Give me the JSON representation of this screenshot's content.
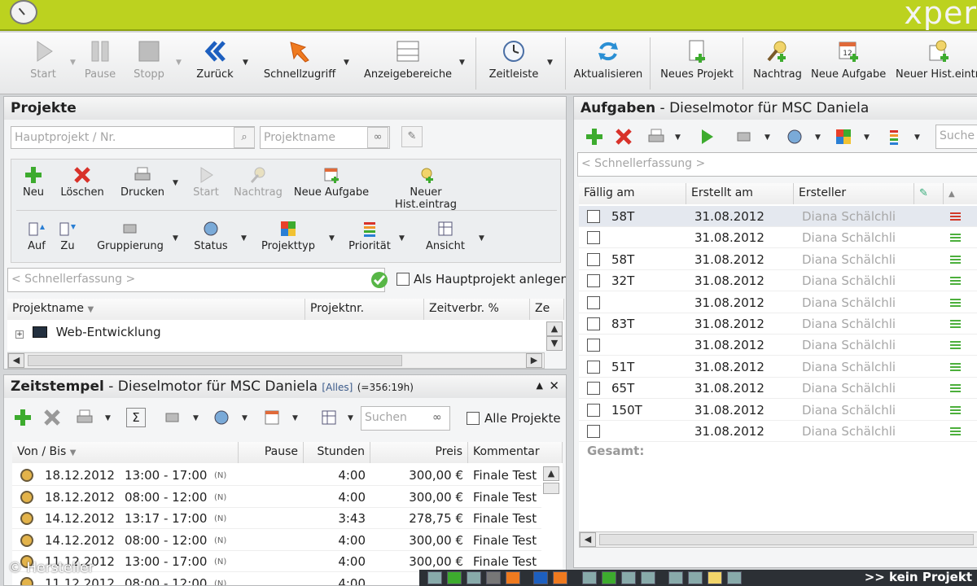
{
  "window": {
    "brand": "xper"
  },
  "toolbar": {
    "buttons": [
      {
        "label": "Start",
        "icon": "play-icon",
        "disabled": true
      },
      {
        "label": "Pause",
        "icon": "pause-icon",
        "disabled": true
      },
      {
        "label": "Stopp",
        "icon": "stop-icon",
        "disabled": true
      },
      {
        "label": "Zurück",
        "icon": "back-icon",
        "disabled": false
      },
      {
        "label": "Schnellzugriff",
        "icon": "quick-access-icon",
        "disabled": false
      },
      {
        "label": "Anzeigebereiche",
        "icon": "display-areas-icon",
        "disabled": false
      },
      {
        "label": "Zeitleiste",
        "icon": "clock-icon",
        "disabled": false
      },
      {
        "label": "Aktualisieren",
        "icon": "refresh-icon",
        "disabled": false
      },
      {
        "label": "Neues Projekt",
        "icon": "new-project-icon",
        "disabled": false
      },
      {
        "label": "Nachtrag",
        "icon": "addendum-icon",
        "disabled": false
      },
      {
        "label": "Neue Aufgabe",
        "icon": "new-task-icon",
        "disabled": false
      },
      {
        "label": "Neuer Hist.eintr.",
        "icon": "new-history-icon",
        "disabled": false
      }
    ]
  },
  "projects": {
    "title": "Projekte",
    "main_project_placeholder": "Hauptprojekt / Nr.",
    "project_name_placeholder": "Projektname",
    "actions_row1": [
      {
        "label": "Neu",
        "disabled": false
      },
      {
        "label": "Löschen",
        "disabled": false
      },
      {
        "label": "Drucken",
        "disabled": false
      },
      {
        "label": "Start",
        "disabled": true
      },
      {
        "label": "Nachtrag",
        "disabled": true
      },
      {
        "label": "Neue Aufgabe",
        "disabled": false
      },
      {
        "label": "Neuer Hist.eintrag",
        "disabled": false
      }
    ],
    "actions_row2": [
      {
        "label": "Auf"
      },
      {
        "label": "Zu"
      },
      {
        "label": "Gruppierung"
      },
      {
        "label": "Status"
      },
      {
        "label": "Projekttyp"
      },
      {
        "label": "Priorität"
      },
      {
        "label": "Ansicht"
      }
    ],
    "quick_entry_placeholder": "< Schnellerfassung >",
    "as_main_project_label": "Als Hauptprojekt anlegen",
    "columns": [
      "Projektname",
      "Projektnr.",
      "Zeitverbr. %",
      "Ze"
    ],
    "rows": [
      {
        "name": "Web-Entwicklung",
        "nr": "",
        "pct": ""
      }
    ]
  },
  "timestamps": {
    "title": "Zeitstempel",
    "subtitle": "Dieselmotor für MSC Daniela",
    "filter": "[Alles]",
    "summary": "(=356:19h)",
    "search_placeholder": "Suchen",
    "all_projects_label": "Alle Projekte",
    "columns": [
      "Von / Bis",
      "Pause",
      "Stunden",
      "Preis",
      "Kommentar"
    ],
    "rows": [
      {
        "date": "18.12.2012",
        "time": "13:00 - 17:00",
        "flag": "(N)",
        "pause": "",
        "hours": "4:00",
        "price": "300,00 €",
        "comment": "Finale Test"
      },
      {
        "date": "18.12.2012",
        "time": "08:00 - 12:00",
        "flag": "(N)",
        "pause": "",
        "hours": "4:00",
        "price": "300,00 €",
        "comment": "Finale Test"
      },
      {
        "date": "14.12.2012",
        "time": "13:17 - 17:00",
        "flag": "(N)",
        "pause": "",
        "hours": "3:43",
        "price": "278,75 €",
        "comment": "Finale Test"
      },
      {
        "date": "14.12.2012",
        "time": "08:00 - 12:00",
        "flag": "(N)",
        "pause": "",
        "hours": "4:00",
        "price": "300,00 €",
        "comment": "Finale Test"
      },
      {
        "date": "11.12.2012",
        "time": "13:00 - 17:00",
        "flag": "(N)",
        "pause": "",
        "hours": "4:00",
        "price": "300,00 €",
        "comment": "Finale Test"
      },
      {
        "date": "11.12.2012",
        "time": "08:00 - 12:00",
        "flag": "(N)",
        "pause": "",
        "hours": "4:00",
        "price": "",
        "comment": ""
      }
    ]
  },
  "tasks": {
    "title": "Aufgaben",
    "subtitle": "Dieselmotor für MSC Daniela",
    "search_placeholder": "Suche",
    "quick_entry_placeholder": "< Schnellerfassung >",
    "columns": [
      "Fällig am",
      "Erstellt am",
      "Ersteller"
    ],
    "total_label": "Gesamt:",
    "rows": [
      {
        "due": "58T",
        "created": "31.08.2012",
        "creator": "Diana Schälchli",
        "prio": "red"
      },
      {
        "due": "",
        "created": "31.08.2012",
        "creator": "Diana Schälchli",
        "prio": "green"
      },
      {
        "due": "58T",
        "created": "31.08.2012",
        "creator": "Diana Schälchli",
        "prio": "green"
      },
      {
        "due": "32T",
        "created": "31.08.2012",
        "creator": "Diana Schälchli",
        "prio": "green"
      },
      {
        "due": "",
        "created": "31.08.2012",
        "creator": "Diana Schälchli",
        "prio": "green"
      },
      {
        "due": "83T",
        "created": "31.08.2012",
        "creator": "Diana Schälchli",
        "prio": "green"
      },
      {
        "due": "",
        "created": "31.08.2012",
        "creator": "Diana Schälchli",
        "prio": "green"
      },
      {
        "due": "51T",
        "created": "31.08.2012",
        "creator": "Diana Schälchli",
        "prio": "green"
      },
      {
        "due": "65T",
        "created": "31.08.2012",
        "creator": "Diana Schälchli",
        "prio": "green"
      },
      {
        "due": "150T",
        "created": "31.08.2012",
        "creator": "Diana Schälchli",
        "prio": "green"
      },
      {
        "due": "",
        "created": "31.08.2012",
        "creator": "Diana Schälchli",
        "prio": "green"
      }
    ]
  },
  "statusbar": {
    "text": ">> kein Projekt"
  },
  "copyright": "© Hersteller"
}
